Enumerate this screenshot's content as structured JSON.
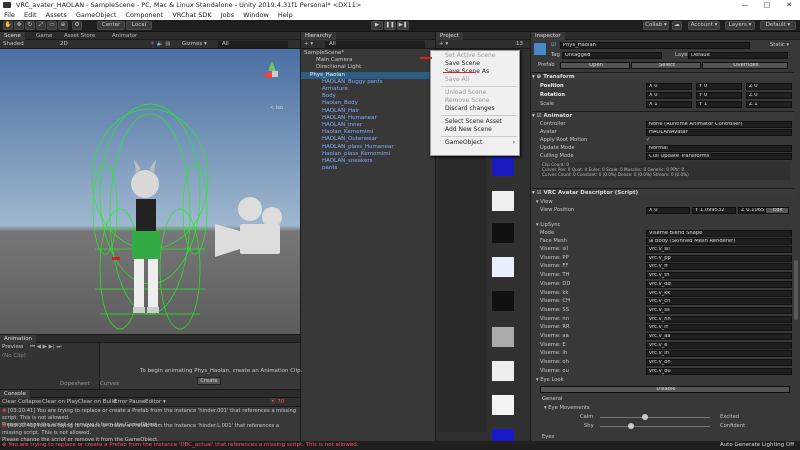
{
  "window": {
    "title": "VRC_avater_HAOLAN - SampleScene - PC, Mac & Linux Standalone - Unity 2019.4.31f1 Personal* <DX11>",
    "min": "—",
    "max": "□",
    "close": "✕"
  },
  "menubar": [
    "File",
    "Edit",
    "Assets",
    "GameObject",
    "Component",
    "VRChat SDK",
    "Jobs",
    "Window",
    "Help"
  ],
  "toolbar": {
    "center": "Center",
    "local": "Local",
    "collab": "Collab ▾",
    "account": "Account ▾",
    "layers": "Layers ▾",
    "layout": "Default ▾"
  },
  "scene": {
    "tabs": [
      "Scene",
      "Game",
      "Asset Store",
      "Animator"
    ],
    "shading": "Shaded",
    "mode": "2D",
    "gizmos": "Gizmos ▾",
    "all": "All",
    "view_label": "< Iso"
  },
  "hierarchy": {
    "tab": "Hierarchy",
    "search_placeholder": "All",
    "items": [
      {
        "label": "SampleScene*",
        "indent": 0
      },
      {
        "label": "Main Camera",
        "indent": 2
      },
      {
        "label": "Directional Light",
        "indent": 2
      },
      {
        "label": "Phys_Haolan",
        "indent": 1
      },
      {
        "label": "HAOLAN_Buggy pants",
        "indent": 3
      },
      {
        "label": "Armature",
        "indent": 3
      },
      {
        "label": "Body",
        "indent": 3
      },
      {
        "label": "Haolan_Body",
        "indent": 3
      },
      {
        "label": "HAOLAN_Hair",
        "indent": 3
      },
      {
        "label": "HAOLAN_Humanear",
        "indent": 3
      },
      {
        "label": "HAOLAN_Inner",
        "indent": 3
      },
      {
        "label": "Haolan_Kemomimi",
        "indent": 3
      },
      {
        "label": "HAOLAN_Outerwear",
        "indent": 3
      },
      {
        "label": "HAOLAN_plass_Humanear",
        "indent": 3
      },
      {
        "label": "Haolan_plass_Kemomimi",
        "indent": 3
      },
      {
        "label": "HAOLAN_sneakers",
        "indent": 3
      },
      {
        "label": "pants",
        "indent": 3
      }
    ]
  },
  "context_menu": {
    "items": [
      {
        "label": "Set Active Scene",
        "disabled": true
      },
      {
        "label": "Save Scene",
        "disabled": false
      },
      {
        "label": "Save Scene As",
        "disabled": false
      },
      {
        "label": "Save All",
        "disabled": true
      },
      {
        "sep": true
      },
      {
        "label": "Unload Scene",
        "disabled": true
      },
      {
        "label": "Remove Scene",
        "disabled": true
      },
      {
        "label": "Discard changes",
        "disabled": false
      },
      {
        "sep": true
      },
      {
        "label": "Select Scene Asset",
        "disabled": false
      },
      {
        "label": "Add New Scene",
        "disabled": false
      },
      {
        "sep": true
      },
      {
        "label": "GameObject",
        "disabled": false,
        "arrow": "›"
      }
    ]
  },
  "project": {
    "tab": "Project",
    "count": "13"
  },
  "animation": {
    "tab": "Animation",
    "preview": "Preview",
    "samples": "(No Clip)",
    "msg": "To begin animating Phys_Haolan, create an Animation Clip.",
    "create": "Create",
    "dopesheet": "Dopesheet",
    "curves": "Curves"
  },
  "console": {
    "tab": "Console",
    "buttons": [
      "Clear",
      "Collapse",
      "Clear on Play",
      "Clear on Build",
      "Error Pause",
      "Editor ▾"
    ],
    "count": "70",
    "lines": [
      {
        "time": "[03:10:41]",
        "text": "You are trying to replace or create a Prefab from the instance 'hinder.001' that references a missing script. This is not allowed.",
        "text2": "Please change the script or remove it from the GameObject."
      },
      {
        "time": "[03:10:41]",
        "text": "You are trying to replace or create a Prefab from the instance 'hinder.L.001' that references a missing script. This is not allowed.",
        "text2": "Please change the script or remove it from the GameObject."
      }
    ]
  },
  "status": {
    "error": "You are trying to replace or create a Prefab from the instance 'DBC_actual' that references a missing script. This is not allowed.",
    "right": "Auto Generate Lighting Off"
  },
  "inspector": {
    "tab": "Inspector",
    "name": "Phys_Haolan",
    "static": "Static ▾",
    "tag_label": "Tag",
    "tag": "Untagged",
    "layer_label": "Layer",
    "layer": "Default",
    "prefab_label": "Prefab",
    "prefab_open": "Open",
    "prefab_select": "Select",
    "prefab_overrides": "Overrides",
    "transform": {
      "title": "Transform",
      "rows": [
        {
          "label": "Position",
          "x": "0",
          "y": "0",
          "z": "0"
        },
        {
          "label": "Rotation",
          "x": "0",
          "y": "0",
          "z": "0"
        },
        {
          "label": "Scale",
          "x": "1",
          "y": "1",
          "z": "1"
        }
      ]
    },
    "animator": {
      "title": "Animator",
      "rows": [
        {
          "label": "Controller",
          "value": "None (Runtime Animator Controller)"
        },
        {
          "label": "Avatar",
          "value": "HAOLANAvatar"
        },
        {
          "label": "Apply Root Motion",
          "value": "✓"
        },
        {
          "label": "Update Mode",
          "value": "Normal"
        },
        {
          "label": "Culling Mode",
          "value": "Cull Update Transforms"
        }
      ],
      "info": [
        "Clip Count: 0",
        "Curves Pos: 0 Quat: 0 Euler: 0 Scale: 0 Muscles: 0 Generic: 0 PPtr: 0",
        "Curves Count: 0 Constant: 0 (0.0%) Dense: 0 (0.0%) Stream: 0 (0.0%)"
      ]
    },
    "descriptor": {
      "title": "VRC Avatar Descriptor (Script)",
      "view": "View",
      "view_pos_label": "View Position",
      "vx": "0",
      "vy": "1.099532",
      "vz": "0.1065509",
      "edit": "Edit",
      "lipsync": "LipSync",
      "mode_label": "Mode",
      "mode": "Viseme Blend Shape",
      "face_label": "Face Mesh",
      "face": "Body (Skinned Mesh Renderer)",
      "visemes": [
        {
          "label": "Viseme: sil",
          "value": "vrc.v_sil"
        },
        {
          "label": "Viseme: PP",
          "value": "vrc.v_pp"
        },
        {
          "label": "Viseme: FF",
          "value": "vrc.v_ff"
        },
        {
          "label": "Viseme: TH",
          "value": "vrc.v_th"
        },
        {
          "label": "Viseme: DD",
          "value": "vrc.v_dd"
        },
        {
          "label": "Viseme: kk",
          "value": "vrc.v_kk"
        },
        {
          "label": "Viseme: CH",
          "value": "vrc.v_ch"
        },
        {
          "label": "Viseme: SS",
          "value": "vrc.v_ss"
        },
        {
          "label": "Viseme: nn",
          "value": "vrc.v_nn"
        },
        {
          "label": "Viseme: RR",
          "value": "vrc.v_rr"
        },
        {
          "label": "Viseme: aa",
          "value": "vrc.v_aa"
        },
        {
          "label": "Viseme: E",
          "value": "vrc.v_e"
        },
        {
          "label": "Viseme: ih",
          "value": "vrc.v_ih"
        },
        {
          "label": "Viseme: oh",
          "value": "vrc.v_oh"
        },
        {
          "label": "Viseme: ou",
          "value": "vrc.v_ou"
        }
      ],
      "eyelook": "Eye Look",
      "disable": "Disable",
      "general": "General",
      "eye_movements": "Eye Movements",
      "calm": "Calm",
      "excited": "Excited",
      "shy": "Shy",
      "confident": "Confident",
      "eyes": "Eyes"
    }
  }
}
